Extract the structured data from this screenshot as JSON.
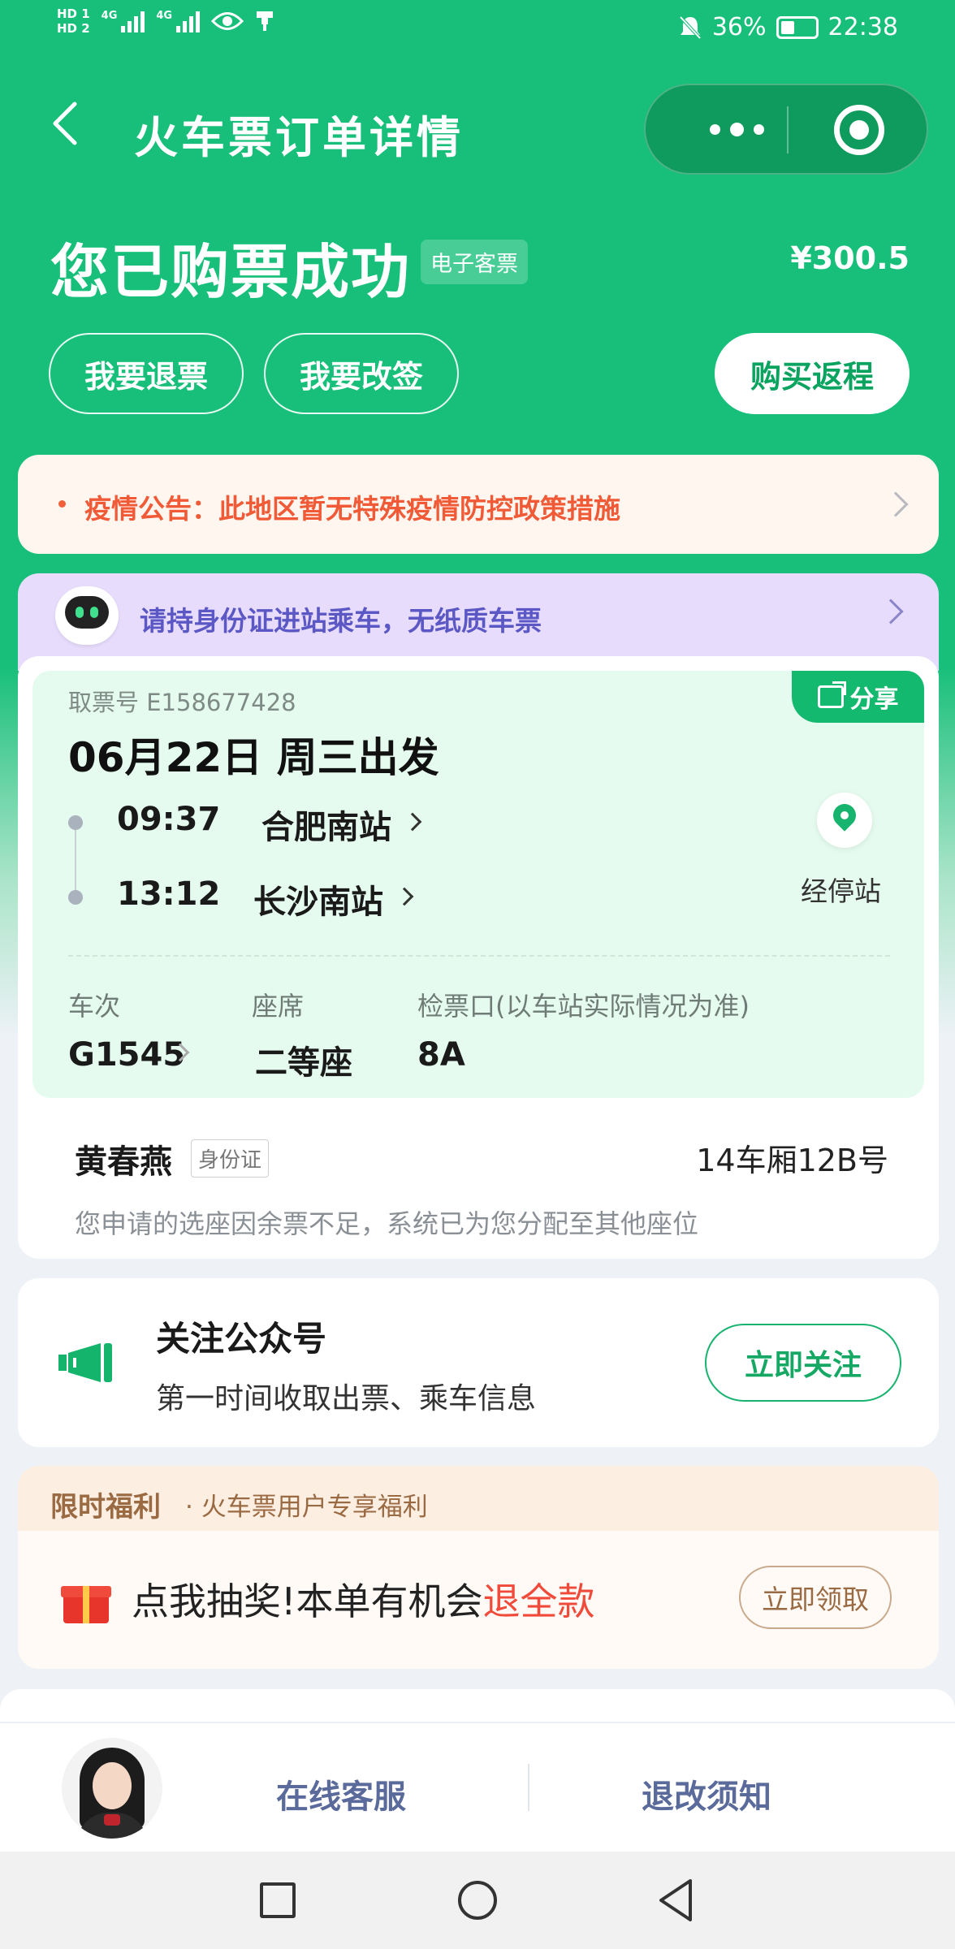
{
  "status_bar": {
    "hd1": "HD 1",
    "hd2": "HD 2",
    "net1": "4G",
    "net2": "4G",
    "battery": "36%",
    "time": "22:38"
  },
  "nav": {
    "title": "火车票订单详情"
  },
  "header": {
    "status": "您已购票成功",
    "eticket_badge": "电子客票",
    "price": "¥300.5",
    "refund_label": "我要退票",
    "change_label": "我要改签",
    "return_label": "购买返程"
  },
  "notice": {
    "text": "疫情公告：此地区暂无特殊疫情防控政策措施"
  },
  "idcard_banner": {
    "text": "请持身份证进站乘车，无纸质车票"
  },
  "ticket": {
    "share_label": "分享",
    "pickup_no": "取票号 E158677428",
    "date": "06月22日 周三出发",
    "depart_time": "09:37",
    "depart_station": "合肥南站",
    "arrive_time": "13:12",
    "arrive_station": "长沙南站",
    "stops_label": "经停站",
    "train_label": "车次",
    "train_no": "G1545",
    "seat_label": "座席",
    "seat_class": "二等座",
    "gate_label": "检票口(以车站实际情况为准)",
    "gate": "8A",
    "passenger_name": "黄春燕",
    "id_type": "身份证",
    "seat_no": "14车厢12B号",
    "seat_note": "您申请的选座因余票不足，系统已为您分配至其他座位"
  },
  "follow": {
    "title": "关注公众号",
    "subtitle": "第一时间收取出票、乘车信息",
    "button": "立即关注"
  },
  "benefit": {
    "tag": "限时福利",
    "sub": "· 火车票用户专享福利",
    "main_prefix": "点我抽奖!本单有机会",
    "main_highlight": "退全款",
    "button": "立即领取"
  },
  "bottom_bar": {
    "customer_service": "在线客服",
    "refund_notice": "退改须知"
  },
  "colors": {
    "brand_green": "#17bf7a",
    "notice_red": "#f05a36",
    "highlight_red": "#f04b3a",
    "link_blue": "#5a6a9a"
  }
}
